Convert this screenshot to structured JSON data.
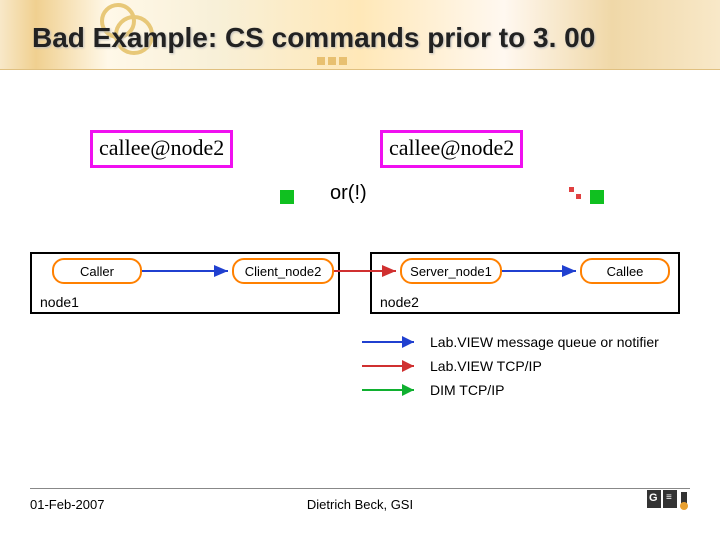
{
  "slide": {
    "title": "Bad Example: CS commands prior to 3. 00",
    "callee_label_left": "callee@node2",
    "callee_label_right": "callee@node2",
    "or_label": "or(!)",
    "diagram": {
      "node1_caption": "node1",
      "node2_caption": "node2",
      "caller": "Caller",
      "client": "Client_node2",
      "server": "Server_node1",
      "callee": "Callee"
    },
    "legend": {
      "item1": "Lab.VIEW message queue or notifier",
      "item2": "Lab.VIEW TCP/IP",
      "item3": "DIM TCP/IP"
    },
    "footer": {
      "date": "01-Feb-2007",
      "author": "Dietrich Beck, GSI",
      "logo_text": "GSI"
    }
  }
}
